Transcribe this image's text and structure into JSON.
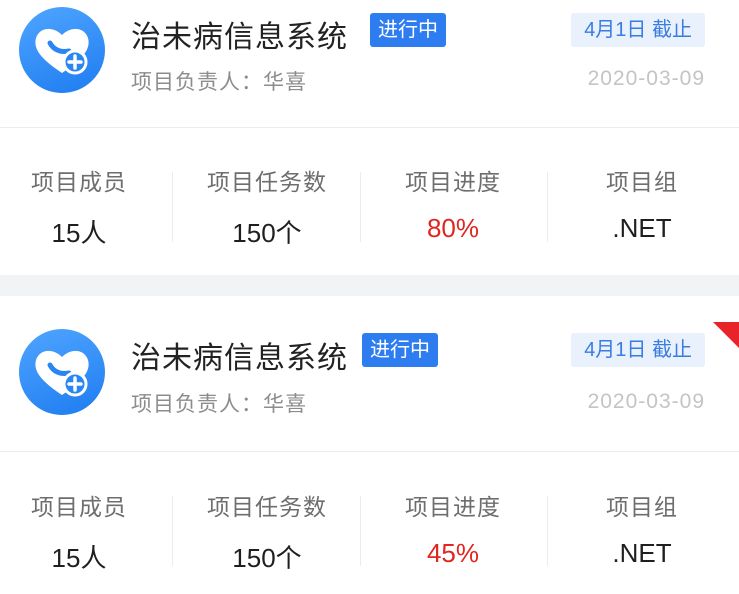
{
  "projects": [
    {
      "name": "治未病信息系统",
      "status": "进行中",
      "deadline": "4月1日 截止",
      "owner": "项目负责人：华喜",
      "date": "2020-03-09",
      "stats": [
        {
          "label": "项目成员",
          "value": "15人"
        },
        {
          "label": "项目任务数",
          "value": "150个"
        },
        {
          "label": "项目进度",
          "value": "80%"
        },
        {
          "label": "项目组",
          "value": ".NET"
        }
      ],
      "progress_fraction": 0.8,
      "colors": {
        "progress": "#e0261f",
        "status_bg": "#2e7df0",
        "deadline_bg": "#e9f1fd"
      }
    },
    {
      "name": "治未病信息系统",
      "status": "进行中",
      "deadline": "4月1日 截止",
      "owner": "项目负责人：华喜",
      "date": "2020-03-09",
      "stats": [
        {
          "label": "项目成员",
          "value": "15人"
        },
        {
          "label": "项目任务数",
          "value": "150个"
        },
        {
          "label": "项目进度",
          "value": "45%"
        },
        {
          "label": "项目组",
          "value": ".NET"
        }
      ],
      "progress_fraction": 0.45,
      "flag": "red-corner-flag-icon",
      "colors": {
        "progress": "#e0261f",
        "flag": "#e8232a"
      }
    }
  ],
  "icons": {
    "logo": "heart-plus-icon"
  }
}
